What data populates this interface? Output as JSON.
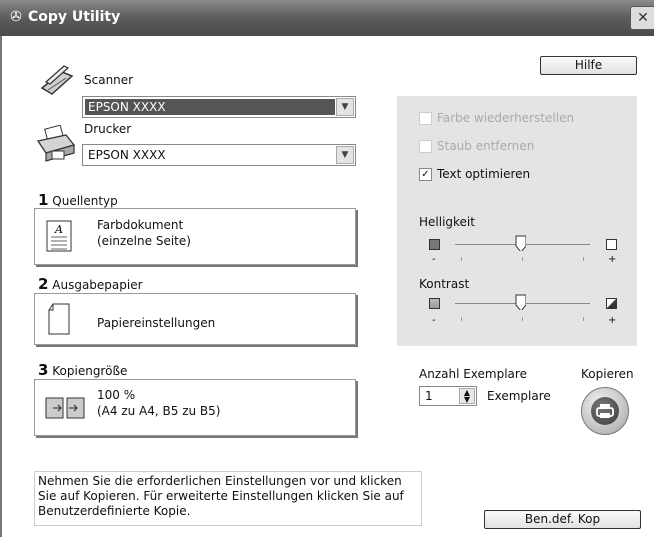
{
  "window": {
    "title": "Copy Utility",
    "close_glyph": "✕"
  },
  "buttons": {
    "help": "Hilfe",
    "custom": "Ben.def. Kop"
  },
  "devices": {
    "scanner_label": "Scanner",
    "scanner_value": "EPSON XXXX",
    "printer_label": "Drucker",
    "printer_value": "EPSON XXXX"
  },
  "sections": [
    {
      "num": "1",
      "label": "Quellentyp",
      "line1": "Farbdokument",
      "line2": "(einzelne Seite)",
      "icon": "document-icon"
    },
    {
      "num": "2",
      "label": "Ausgabepapier",
      "line1": "Papiereinstellungen",
      "icon": "paper-icon"
    },
    {
      "num": "3",
      "label": "Kopiengröße",
      "line1": "100 %",
      "line2": "(A4 zu A4, B5 zu B5)",
      "icon": "resize-icon"
    }
  ],
  "options": {
    "restore_color": {
      "label": "Farbe wiederherstellen",
      "checked": false,
      "enabled": false
    },
    "remove_dust": {
      "label": "Staub entfernen",
      "checked": false,
      "enabled": false
    },
    "optimize_text": {
      "label": "Text optimieren",
      "checked": true,
      "enabled": true
    }
  },
  "brightness": {
    "label": "Helligkeit",
    "minus": "-",
    "plus": "+",
    "value": 0.5
  },
  "contrast": {
    "label": "Kontrast",
    "minus": "-",
    "plus": "+",
    "value": 0.5
  },
  "copies": {
    "label": "Anzahl Exemplare",
    "value": "1",
    "unit": "Exemplare"
  },
  "copy": {
    "label": "Kopieren"
  },
  "message": "Nehmen Sie die erforderlichen Einstellungen vor und klicken Sie auf Kopieren.  Für erweiterte Einstellungen klicken Sie auf Benutzerdefinierte Kopie."
}
